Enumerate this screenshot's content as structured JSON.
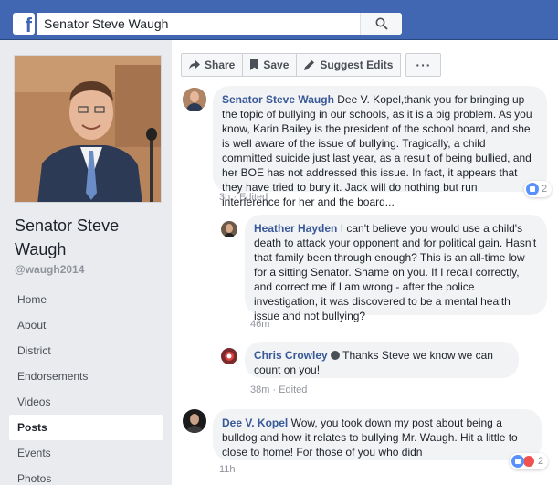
{
  "header": {
    "logo": "f",
    "search_value": "Senator Steve Waugh",
    "search_icon": "search-icon"
  },
  "sidebar": {
    "page_name": "Senator Steve Waugh",
    "handle": "@waugh2014",
    "nav": [
      {
        "label": "Home",
        "active": false
      },
      {
        "label": "About",
        "active": false
      },
      {
        "label": "District",
        "active": false
      },
      {
        "label": "Endorsements",
        "active": false
      },
      {
        "label": "Videos",
        "active": false
      },
      {
        "label": "Posts",
        "active": true
      },
      {
        "label": "Events",
        "active": false
      },
      {
        "label": "Photos",
        "active": false
      }
    ]
  },
  "actions": {
    "share": "Share",
    "save": "Save",
    "suggest": "Suggest Edits",
    "more": "···"
  },
  "comments": [
    {
      "author": "Senator Steve Waugh",
      "text": "Dee V. Kopel,thank you for bringing up the topic of bullying in our schools, as it is a big problem. As you know, Karin Bailey is the president of the school board, and she is well aware of the issue of bullying. Tragically, a child committed suicide just last year, as a result of being bullied, and her BOE has not addressed this issue. In fact, it appears that they have tried to bury it. Jack will do nothing but run interference for her and the board...",
      "time": "3h",
      "edited": "Edited",
      "reactions": "2"
    },
    {
      "author": "Heather Hayden",
      "text": "I can't believe you would use a child's death to attack your opponent and for political gain. Hasn't that family been through enough? This is an all-time low for a sitting Senator. Shame on you. If I recall correctly, and correct me if I am wrong - after the police investigation, it was discovered to be a mental health issue and not bullying?",
      "time": "46m"
    },
    {
      "author": "Chris Crowley",
      "text": "Thanks Steve we know we can count on you!",
      "time": "38m",
      "edited": "Edited"
    },
    {
      "author": "Dee V. Kopel",
      "text": "Wow, you took down my post about being a bulldog and how it relates to bullying Mr. Waugh. Hit a little to close to home! For those of you who didn",
      "time": "11h",
      "reactions": "2"
    }
  ],
  "colors": {
    "brand": "#4267b2",
    "link": "#385898",
    "bubble": "#f2f3f5",
    "like": "#5890ff",
    "angry": "#f0524f"
  }
}
